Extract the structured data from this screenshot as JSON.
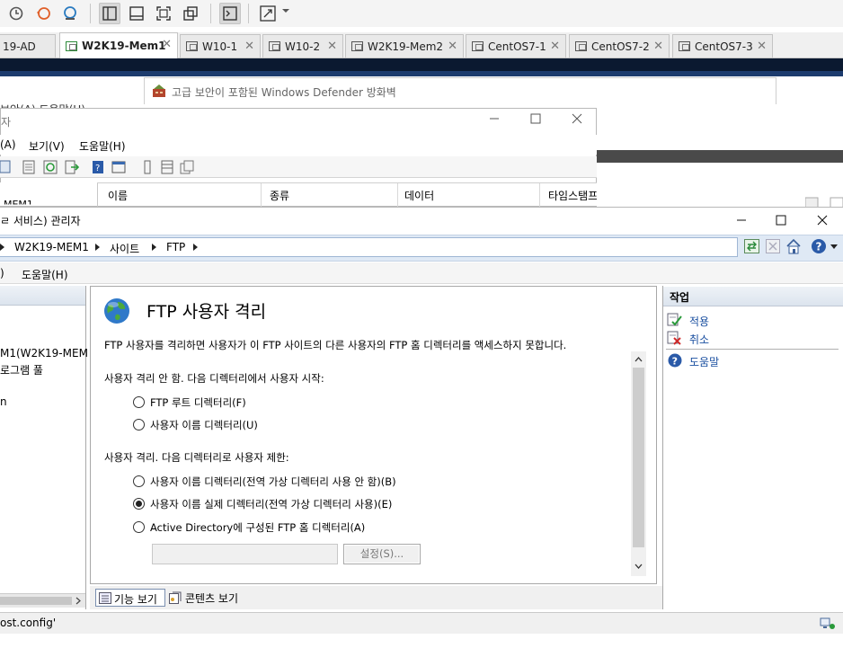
{
  "vm_tabs": [
    {
      "label": "19-AD"
    },
    {
      "label": "W2K19-Mem1"
    },
    {
      "label": "W10-1"
    },
    {
      "label": "W10-2"
    },
    {
      "label": "W2K19-Mem2"
    },
    {
      "label": "CentOS7-1"
    },
    {
      "label": "CentOS7-2"
    },
    {
      "label": "CentOS7-3"
    }
  ],
  "background_windows": {
    "defender_title": "고급 보안이 포함된 Windows Defender 방화벽",
    "left_fragment_1": "보안(A)   도움말(H)",
    "dns_title_fragment": "자",
    "dns_menu": [
      "(A)",
      "보기(V)",
      "도움말(H)"
    ],
    "dns_tree_fragment": "-MEM1",
    "dns_columns": [
      "이름",
      "종류",
      "데이터",
      "타임스탬프"
    ]
  },
  "iis": {
    "title": "ㄹ 서비스) 관리자",
    "breadcrumb": [
      "W2K19-MEM1",
      "사이트",
      "FTP"
    ],
    "menu": [
      ")",
      "도움말(H)"
    ],
    "tree_items": [
      "M1(W2K19-MEM",
      "로그램 풀",
      "n"
    ],
    "feature": {
      "title": "FTP 사용자 격리",
      "description": "FTP 사용자를 격리하면 사용자가 이 FTP 사이트의 다른 사용자의 FTP 홈 디렉터리를 액세스하지 못합니다.",
      "section1_label": "사용자 격리 안 함. 다음 디렉터리에서 사용자 시작:",
      "option_ftp_root": "FTP 루트 디렉터리(F)",
      "option_user_dir": "사용자 이름 디렉터리(U)",
      "section2_label": "사용자 격리. 다음 디렉터리로 사용자 제한:",
      "option_user_dir_global_off": "사용자 이름 디렉터리(전역 가상 디렉터리 사용 안 함)(B)",
      "option_user_physical": "사용자 이름 실제 디렉터리(전역 가상 디렉터리 사용)(E)",
      "option_ad": "Active Directory에 구성된 FTP 홈 디렉터리(A)",
      "ad_value": "",
      "settings_button": "설정(S)...",
      "selected_option": "option_user_physical"
    },
    "view_tabs": [
      "기능 보기",
      "콘텐츠 보기"
    ],
    "actions": {
      "header": "작업",
      "apply": "적용",
      "cancel": "취소",
      "help": "도움말"
    },
    "status_text": "ost.config'"
  },
  "colors": {
    "vm_bar": "#0b1930",
    "address_band": "#dfe9f5",
    "link": "#1a4fa0"
  }
}
